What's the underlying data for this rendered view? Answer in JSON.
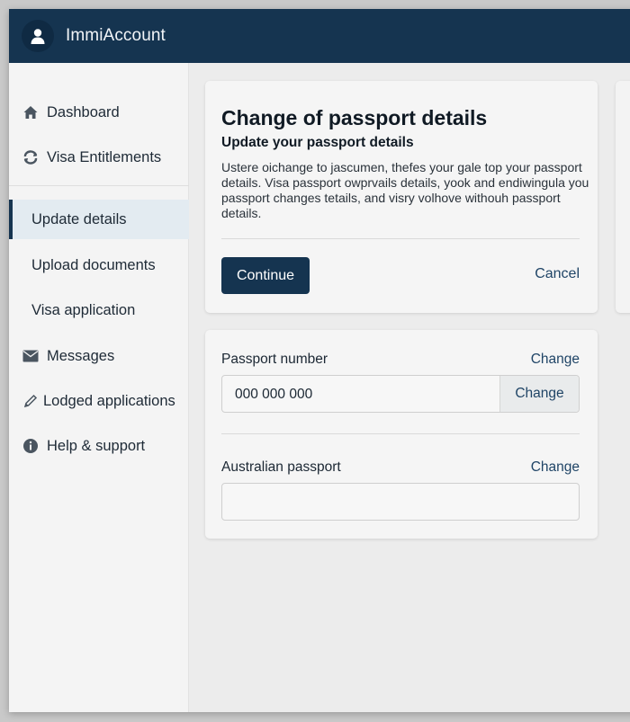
{
  "header": {
    "app_title": "ImmiAccount",
    "icon": "user-avatar-icon"
  },
  "sidebar": {
    "items": [
      {
        "label": "Dashboard",
        "icon": "home-icon"
      },
      {
        "label": "Visa Entitlements",
        "icon": "refresh-icon"
      },
      {
        "label": "Update details",
        "active": true
      },
      {
        "label": "Upload documents"
      },
      {
        "label": "Visa application"
      },
      {
        "label": "Messages",
        "icon": "envelope-icon"
      },
      {
        "label": "Lodged applications",
        "icon": "pencil-icon"
      },
      {
        "label": "Help & support",
        "icon": "info-icon"
      }
    ]
  },
  "main": {
    "title": "Change of passport details",
    "subtitle": "Update your passport details",
    "description": "Ustere oichange to jascumen, thefes your gale top your passport details. Visa passport owprvails details, yook and endiwingula you passport changes tetails, and visry volhove withouh passport details.",
    "continue_label": "Continue",
    "cancel_label": "Cancel"
  },
  "form": {
    "passport_number": {
      "label": "Passport number",
      "link_label": "Change",
      "value": "000 000 000",
      "button_label": "Change"
    },
    "australian_passport": {
      "label": "Australian passport",
      "link_label": "Change",
      "value": ""
    }
  },
  "colors": {
    "brand": "#153450",
    "link": "#1f4466",
    "active_nav": "#e3ebf1"
  }
}
